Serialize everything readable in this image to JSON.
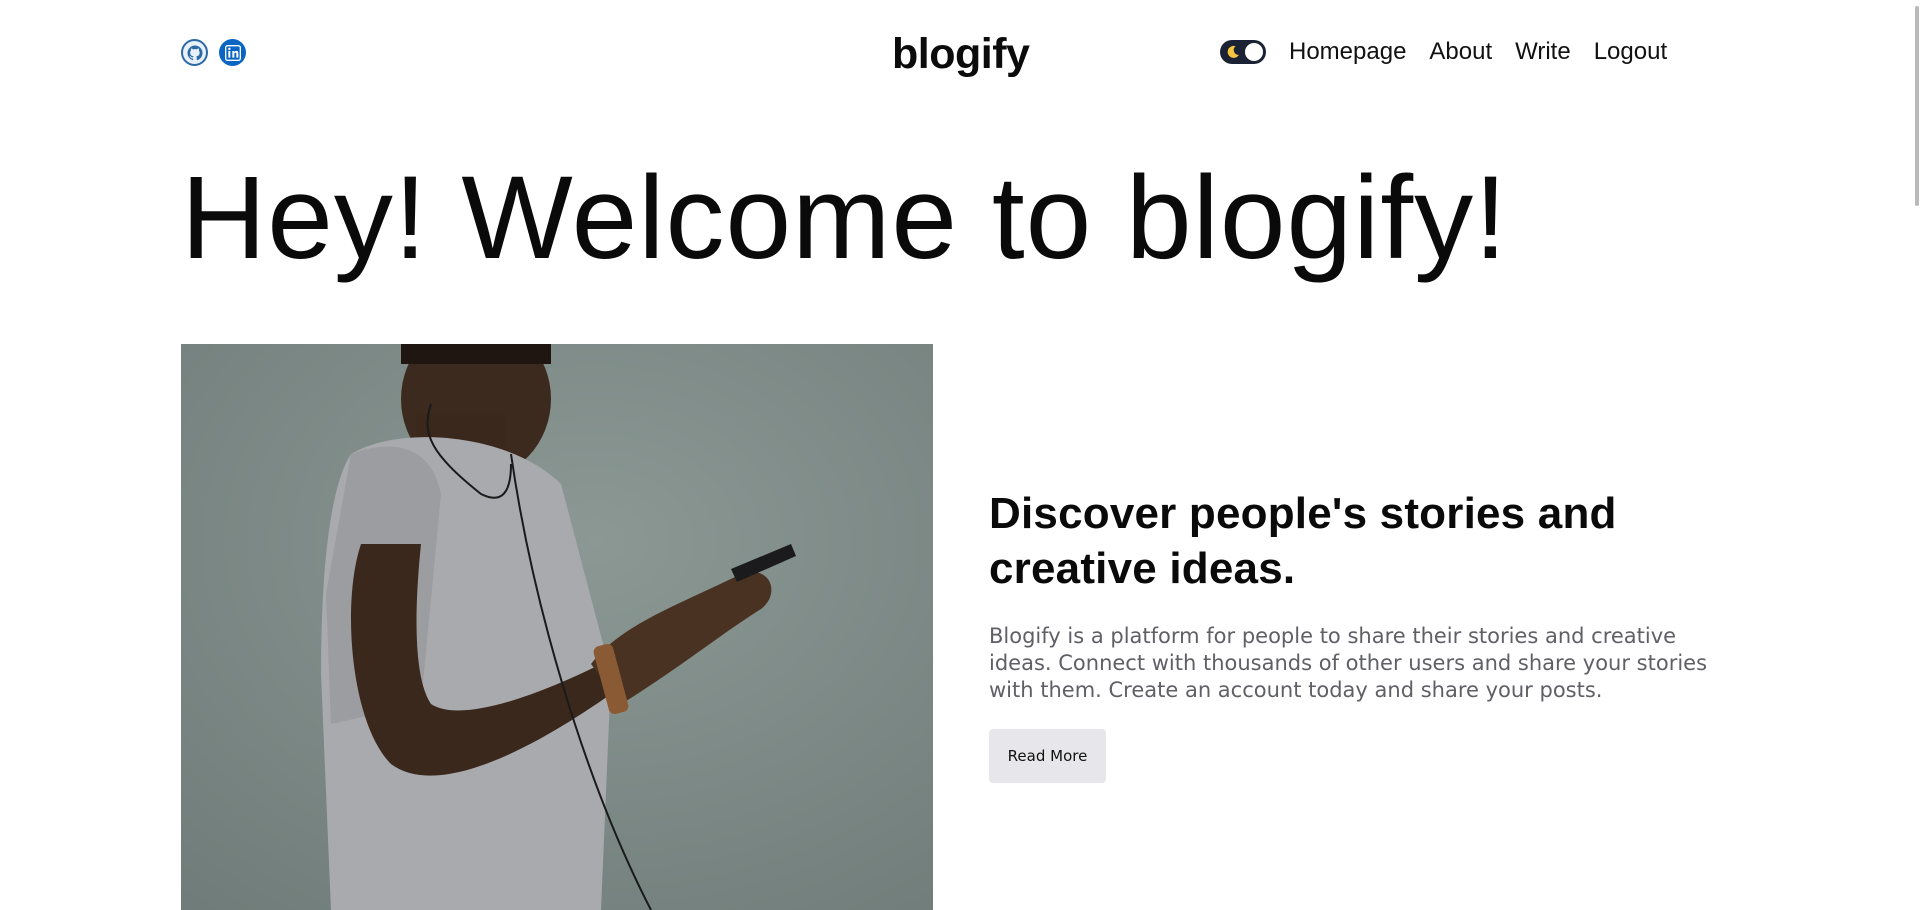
{
  "header": {
    "brand": "blogify",
    "social": [
      {
        "icon": "github-icon"
      },
      {
        "icon": "linkedin-icon"
      }
    ],
    "theme_toggle": {
      "icon": "moon-icon",
      "state": "dark-mode-off"
    },
    "nav": [
      "Homepage",
      "About",
      "Write",
      "Logout"
    ]
  },
  "hero": {
    "title": "Hey! Welcome to blogify!"
  },
  "feature": {
    "image_icon": "photo-person-phone",
    "heading": "Discover people's stories and creative ideas.",
    "description": "Blogify is a platform for people to share their stories and creative ideas. Connect with thousands of other users and share your stories with them. Create an account today and share your posts.",
    "button_label": "Read More"
  },
  "colors": {
    "background": "#ffffff",
    "toggle": "#1a2233",
    "linkedin": "#0a66c2",
    "button_bg": "#e7e6ea",
    "muted_text": "#5f5f66"
  }
}
